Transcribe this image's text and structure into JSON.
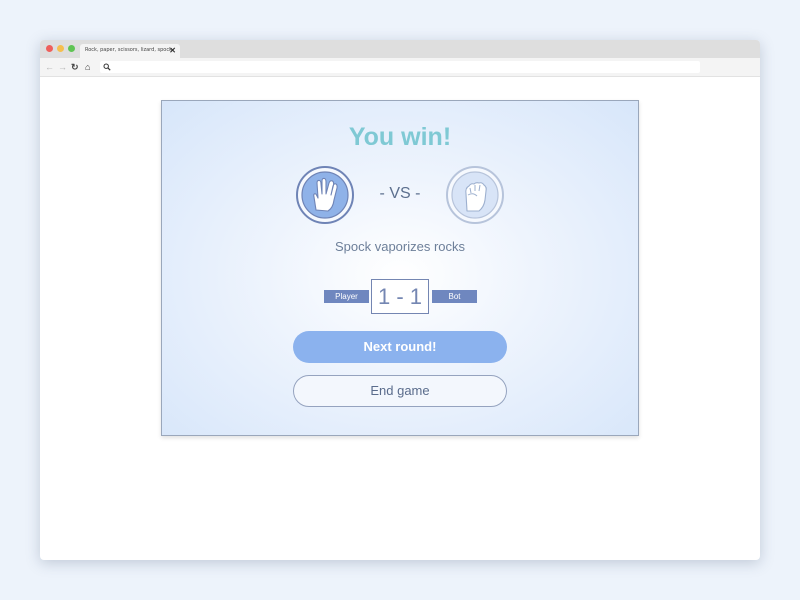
{
  "browser": {
    "tab_title": "Rock, paper, scissors, lizard, spock",
    "tab_close_icon": "close-icon",
    "nav_icons": [
      "back-arrow-icon",
      "forward-arrow-icon",
      "reload-icon",
      "home-icon"
    ],
    "address_icon": "search-icon",
    "address_value": ""
  },
  "game": {
    "title": "You win!",
    "vs_label": "- VS -",
    "player_choice_icon": "spock-hand-icon",
    "bot_choice_icon": "rock-fist-icon",
    "result_text": "Spock vaporizes rocks",
    "score": {
      "player_label": "Player",
      "bot_label": "Bot",
      "display": "1 - 1"
    },
    "next_round_label": "Next round!",
    "end_game_label": "End game"
  },
  "colors": {
    "title": "#7fc9d4",
    "accent": "#6f87bf",
    "primary_button": "#8bb2ee",
    "card_background": "#d7e6fa"
  }
}
